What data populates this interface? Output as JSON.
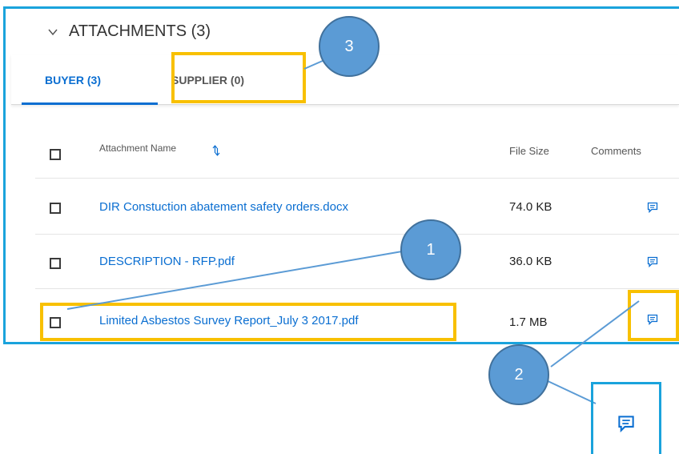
{
  "section": {
    "title": "ATTACHMENTS (3)"
  },
  "tabs": [
    {
      "label": "BUYER (3)"
    },
    {
      "label": "SUPPLIER (0)"
    }
  ],
  "table": {
    "headers": {
      "name": "Attachment Name",
      "size": "File Size",
      "comments": "Comments"
    },
    "rows": [
      {
        "name": "DIR Constuction abatement safety orders.docx",
        "size": "74.0 KB"
      },
      {
        "name": "DESCRIPTION - RFP.pdf",
        "size": "36.0 KB"
      },
      {
        "name": "Limited Asbestos Survey Report_July 3 2017.pdf",
        "size": "1.7 MB"
      }
    ]
  },
  "callouts": {
    "one": "1",
    "two": "2",
    "three": "3"
  },
  "colors": {
    "accent": "#0a6ed1",
    "frame": "#1aa3dc",
    "highlight": "#f8c000",
    "callout": "#5b9bd5"
  },
  "icons": [
    "chevron-down-icon",
    "sort-icon",
    "comment-icon"
  ]
}
